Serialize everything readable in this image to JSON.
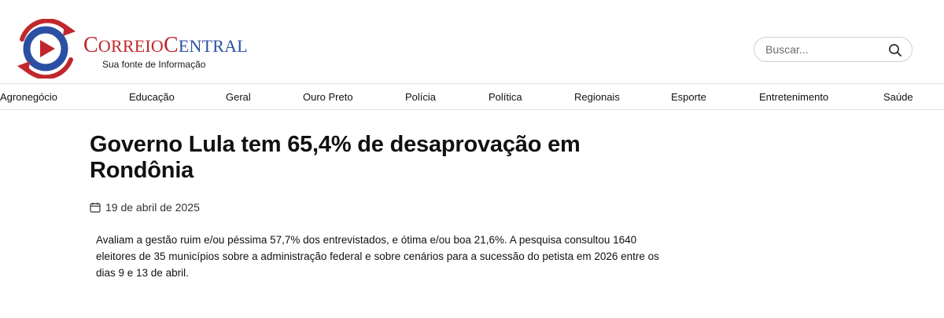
{
  "header": {
    "brand": {
      "correio_initial": "C",
      "correio_rest": "ORREIO",
      "central_initial": "C",
      "central_rest": "ENTRAL",
      "tagline": "Sua fonte de Informação"
    },
    "search": {
      "placeholder": "Buscar...",
      "value": ""
    }
  },
  "nav": {
    "items": [
      {
        "label": "Agronegócio"
      },
      {
        "label": "Educação"
      },
      {
        "label": "Geral"
      },
      {
        "label": "Ouro Preto"
      },
      {
        "label": "Polícia"
      },
      {
        "label": "Política"
      },
      {
        "label": "Regionais"
      },
      {
        "label": "Esporte"
      },
      {
        "label": "Entretenimento"
      },
      {
        "label": "Saúde"
      }
    ]
  },
  "article": {
    "title": "Governo Lula tem 65,4% de desaprovação em Rondônia",
    "date": "19 de abril de 2025",
    "summary": "Avaliam a gestão ruim e/ou péssima 57,7% dos entrevistados, e ótima e/ou boa 21,6%.  A pesquisa consultou 1640 eleitores de 35 municípios sobre a administração federal e sobre cenários para a sucessão do petista em 2026 entre os dias 9 e 13 de abril."
  },
  "colors": {
    "brand_red": "#c0272d",
    "brand_blue": "#2b4fa3"
  },
  "icons": {
    "search": "search-icon",
    "calendar": "calendar-icon",
    "logo": "logo-icon"
  }
}
